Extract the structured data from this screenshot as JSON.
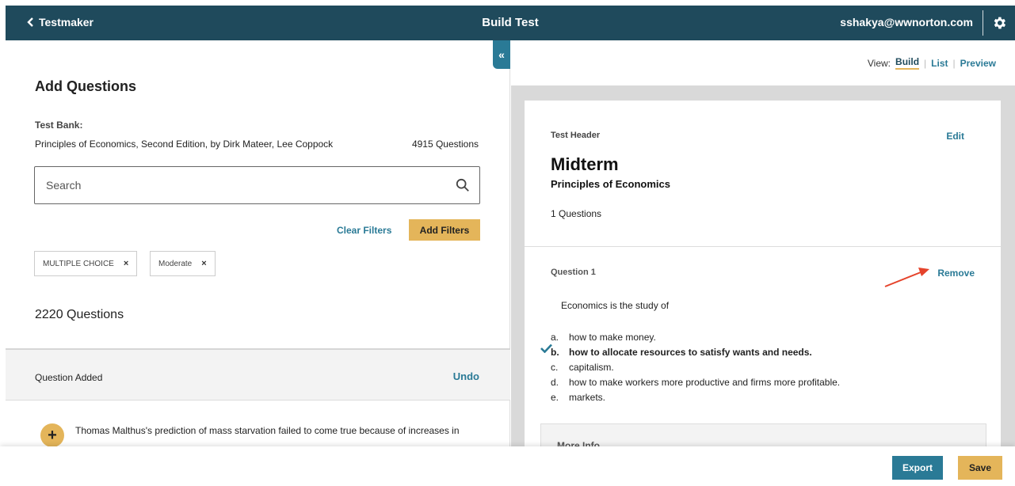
{
  "header": {
    "back_label": "Testmaker",
    "title": "Build Test",
    "user_email": "sshakya@wwnorton.com",
    "icons": {
      "back": "chevron-left-icon",
      "settings": "gear-icon"
    }
  },
  "left_panel": {
    "collapse_label": "«",
    "heading": "Add Questions",
    "test_bank_label": "Test Bank:",
    "test_bank_name": "Principles of Economics, Second Edition, by Dirk Mateer, Lee Coppock",
    "test_bank_count": "4915 Questions",
    "search": {
      "placeholder": "Search",
      "value": "",
      "icon": "search-icon"
    },
    "clear_filters_label": "Clear Filters",
    "add_filters_label": "Add Filters",
    "filters": [
      {
        "label": "MULTIPLE CHOICE",
        "remove": "×"
      },
      {
        "label": "Moderate",
        "remove": "×"
      }
    ],
    "results_count": "2220 Questions",
    "notice": {
      "message": "Question Added",
      "action": "Undo"
    },
    "question_preview": {
      "add_symbol": "+",
      "text": "Thomas Malthus's prediction of mass starvation failed to come true because of increases in"
    }
  },
  "right_panel": {
    "view": {
      "label": "View:",
      "options": [
        "Build",
        "List",
        "Preview"
      ],
      "active": "Build"
    },
    "test_header": {
      "label": "Test Header",
      "edit_label": "Edit",
      "title": "Midterm",
      "subtitle": "Principles of Economics",
      "question_count": "1 Questions"
    },
    "question": {
      "label": "Question 1",
      "remove_label": "Remove",
      "stem": "Economics is the study of",
      "answers": [
        {
          "letter": "a.",
          "text": "how to make money.",
          "correct": false
        },
        {
          "letter": "b.",
          "text": "how to allocate resources to satisfy wants and needs.",
          "correct": true
        },
        {
          "letter": "c.",
          "text": "capitalism.",
          "correct": false
        },
        {
          "letter": "d.",
          "text": "how to make workers more productive and firms more profitable.",
          "correct": false
        },
        {
          "letter": "e.",
          "text": "markets.",
          "correct": false
        }
      ],
      "more_info_label": "More Info",
      "annotation_color": "#e5432b"
    }
  },
  "footer": {
    "export_label": "Export",
    "save_label": "Save"
  },
  "colors": {
    "header_bg": "#1f4a5c",
    "link": "#2a7a96",
    "accent": "#e4b55a",
    "panel_gray": "#d9d9d9"
  }
}
